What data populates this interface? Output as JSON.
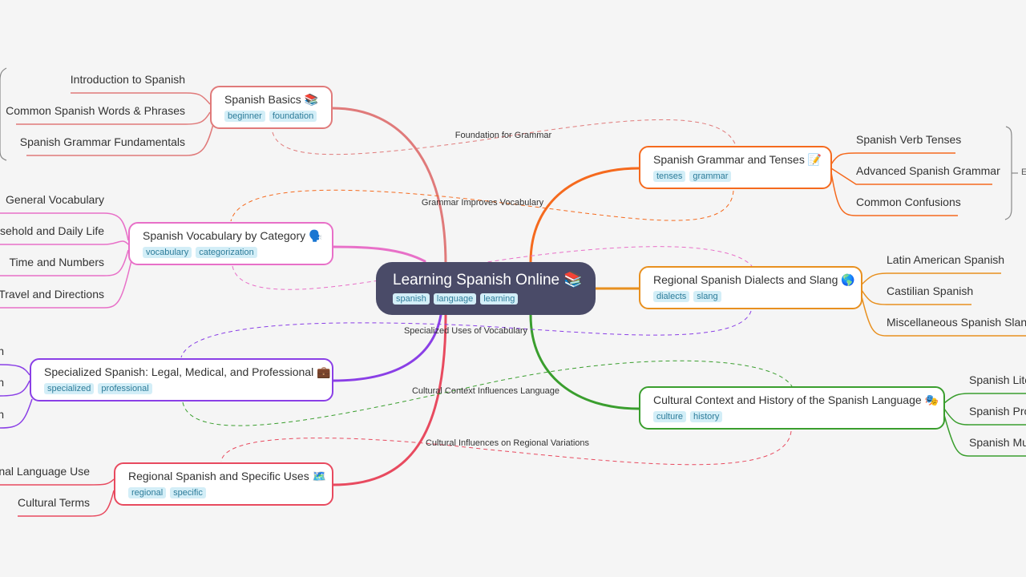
{
  "central": {
    "title": "Learning Spanish Online 📚",
    "tags": [
      "spanish",
      "language",
      "learning"
    ]
  },
  "branches": [
    {
      "title": "Spanish Basics 📚",
      "tags": [
        "beginner",
        "foundation"
      ],
      "color": "#e07a7a",
      "children": [
        "Introduction to Spanish",
        "Common Spanish Words & Phrases",
        "Spanish Grammar Fundamentals"
      ]
    },
    {
      "title": "Spanish Vocabulary by Category 🗣️",
      "tags": [
        "vocabulary",
        "categorization"
      ],
      "color": "#e870c8",
      "children": [
        "General Vocabulary",
        "usehold and Daily Life",
        "Time and Numbers",
        "Travel and Directions"
      ]
    },
    {
      "title": "Specialized Spanish: Legal, Medical, and Professional 💼",
      "tags": [
        "specialized",
        "professional"
      ],
      "color": "#8a3fe6",
      "children": [
        "n",
        "h",
        "n"
      ]
    },
    {
      "title": "Regional Spanish and Specific Uses 🗺️",
      "tags": [
        "regional",
        "specific"
      ],
      "color": "#e84a5f",
      "children": [
        "onal Language Use",
        "Cultural Terms"
      ]
    },
    {
      "title": "Spanish Grammar and Tenses 📝",
      "tags": [
        "tenses",
        "grammar"
      ],
      "color": "#f56a1e",
      "children": [
        "Spanish Verb Tenses",
        "Advanced Spanish Grammar",
        "Common Confusions"
      ],
      "summary": "E"
    },
    {
      "title": "Regional Spanish Dialects and Slang 🌎",
      "tags": [
        "dialects",
        "slang"
      ],
      "color": "#e8901f",
      "children": [
        "Latin American Spanish",
        "Castilian Spanish",
        "Miscellaneous Spanish Slang"
      ]
    },
    {
      "title": "Cultural Context and History of the Spanish Language 🎭",
      "tags": [
        "culture",
        "history"
      ],
      "color": "#3a9e2e",
      "children": [
        "Spanish Lite",
        "Spanish Pro",
        "Spanish Mus"
      ]
    }
  ],
  "relationships": [
    "Foundation for Grammar",
    "Grammar Improves Vocabulary",
    "Specialized Uses of Vocabulary",
    "Cultural Context Influences Language",
    "Cultural Influences on Regional Variations"
  ]
}
